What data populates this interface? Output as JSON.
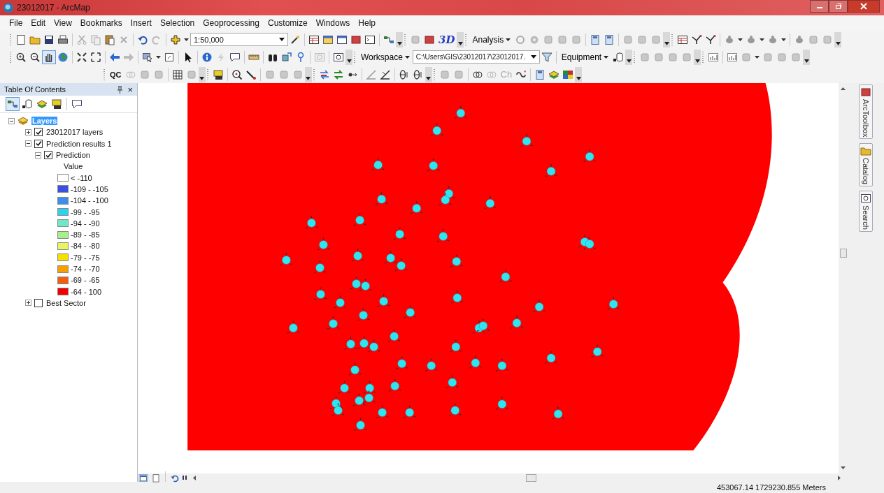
{
  "window": {
    "title": "23012017 - ArcMap"
  },
  "menu": [
    "File",
    "Edit",
    "View",
    "Bookmarks",
    "Insert",
    "Selection",
    "Geoprocessing",
    "Customize",
    "Windows",
    "Help"
  ],
  "toolbars": {
    "scale": "1:50,000",
    "three_d": "3D",
    "analysis": "Analysis",
    "workspace": "Workspace",
    "workspace_path": "C:\\Users\\GIS\\23012017\\23012017.",
    "equipment": "Equipment",
    "qc": "QC",
    "ch": "Ch"
  },
  "toc": {
    "title": "Table Of Contents",
    "close": "×",
    "root": {
      "label": "Layers",
      "selected": true,
      "expanded": true,
      "children": [
        {
          "label": "23012017 layers",
          "checked": true,
          "expanded": false
        },
        {
          "label": "Prediction results 1",
          "checked": true,
          "expanded": true,
          "children": [
            {
              "label": "Prediction",
              "checked": true,
              "expanded": true,
              "legend": {
                "heading": "Value",
                "classes": [
                  {
                    "label": "< -110",
                    "color": "#ffffff"
                  },
                  {
                    "label": "-109 - -105",
                    "color": "#3b4fe0"
                  },
                  {
                    "label": "-104 - -100",
                    "color": "#3d8ee8"
                  },
                  {
                    "label": "-99 - -95",
                    "color": "#2bd3ee"
                  },
                  {
                    "label": "-94 - -90",
                    "color": "#6ee8c8"
                  },
                  {
                    "label": "-89 - -85",
                    "color": "#a8ef8c"
                  },
                  {
                    "label": "-84 - -80",
                    "color": "#e8f560"
                  },
                  {
                    "label": "-79 - -75",
                    "color": "#f5e000"
                  },
                  {
                    "label": "-74 - -70",
                    "color": "#f5a000"
                  },
                  {
                    "label": "-69 - -65",
                    "color": "#f06010"
                  },
                  {
                    "label": "-64 - 100",
                    "color": "#f00000"
                  }
                ]
              }
            }
          ]
        },
        {
          "label": "Best Sector",
          "checked": false,
          "expanded": false
        }
      ]
    }
  },
  "dock_tabs": [
    {
      "label": "ArcToolbox"
    },
    {
      "label": "Catalog"
    },
    {
      "label": "Search"
    }
  ],
  "status_bar": {
    "coordinates": "453067.14  1729230.855 Meters"
  }
}
